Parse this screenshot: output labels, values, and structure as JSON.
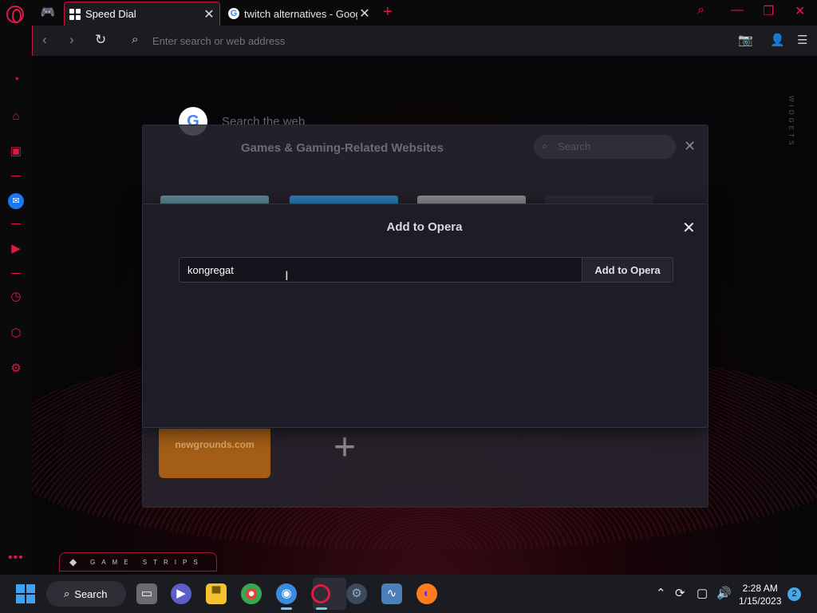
{
  "browser": {
    "tabs": [
      {
        "title": "Speed Dial",
        "active": true
      },
      {
        "title": "twitch alternatives - Google",
        "active": false
      }
    ],
    "address_placeholder": "Enter search or web address"
  },
  "speed_dial": {
    "search_label": "Search the web",
    "widgets_label": "WIDGETS",
    "folder": {
      "title": "Games & Gaming-Related Websites",
      "search_placeholder": "Search",
      "tiles": [
        {
          "label": "newgrounds.com",
          "color": "#a35d16"
        }
      ]
    },
    "game_strips_label": "GAME STRIPS"
  },
  "dialog": {
    "title": "Add to Opera",
    "input_value": "kongregat",
    "button_label": "Add to Opera"
  },
  "taskbar": {
    "search_label": "Search",
    "time": "2:28 AM",
    "date": "1/15/2023",
    "notification_count": "2"
  },
  "colors": {
    "accent": "#e01848",
    "dialog_bg": "#1e1c28",
    "taskbar_bg": "#1b1b22"
  }
}
